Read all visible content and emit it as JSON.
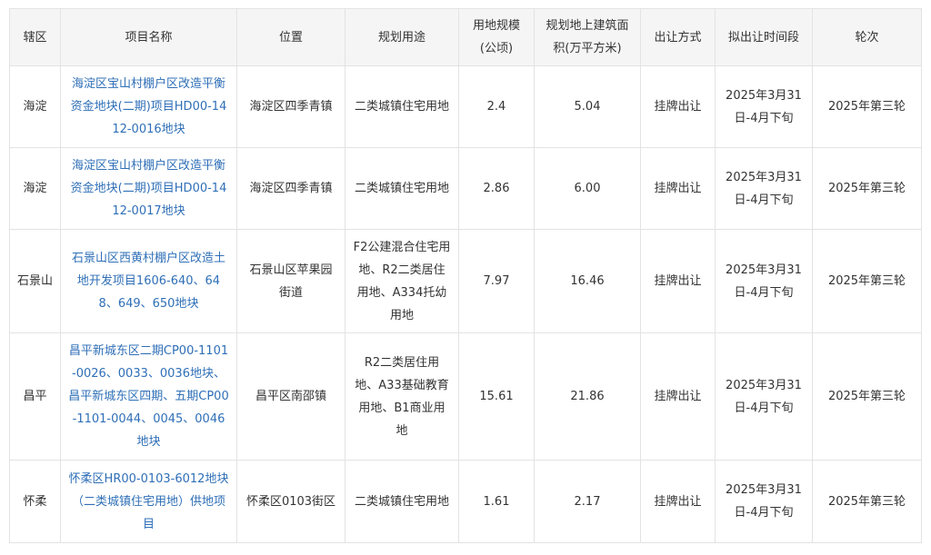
{
  "table": {
    "headers": [
      "辖区",
      "项目名称",
      "位置",
      "规划用途",
      "用地规模(公顷)",
      "规划地上建筑面积(万平方米)",
      "出让方式",
      "拟出让时间段",
      "轮次"
    ],
    "rows": [
      [
        "海淀",
        "海淀区宝山村棚户区改造平衡资金地块(二期)项目HD00-1412-0016地块",
        "海淀区四季青镇",
        "二类城镇住宅用地",
        "2.4",
        "5.04",
        "挂牌出让",
        "2025年3月31日-4月下旬",
        "2025年第三轮"
      ],
      [
        "海淀",
        "海淀区宝山村棚户区改造平衡资金地块(二期)项目HD00-1412-0017地块",
        "海淀区四季青镇",
        "二类城镇住宅用地",
        "2.86",
        "6.00",
        "挂牌出让",
        "2025年3月31日-4月下旬",
        "2025年第三轮"
      ],
      [
        "石景山",
        "石景山区西黄村棚户区改造土地开发项目1606-640、648、649、650地块",
        "石景山区苹果园街道",
        "F2公建混合住宅用地、R2二类居住用地、A334托幼用地",
        "7.97",
        "16.46",
        "挂牌出让",
        "2025年3月31日-4月下旬",
        "2025年第三轮"
      ],
      [
        "昌平",
        "昌平新城东区二期CP00-1101-0026、0033、0036地块、昌平新城东区四期、五期CP00-1101-0044、0045、0046地块",
        "昌平区南邵镇",
        "R2二类居住用地、A33基础教育用地、B1商业用地",
        "15.61",
        "21.86",
        "挂牌出让",
        "2025年3月31日-4月下旬",
        "2025年第三轮"
      ],
      [
        "怀柔",
        "怀柔区HR00-0103-6012地块（二类城镇住宅用地）供地项目",
        "怀柔区0103街区",
        "二类城镇住宅用地",
        "1.61",
        "2.17",
        "挂牌出让",
        "2025年3月31日-4月下旬",
        "2025年第三轮"
      ]
    ]
  }
}
